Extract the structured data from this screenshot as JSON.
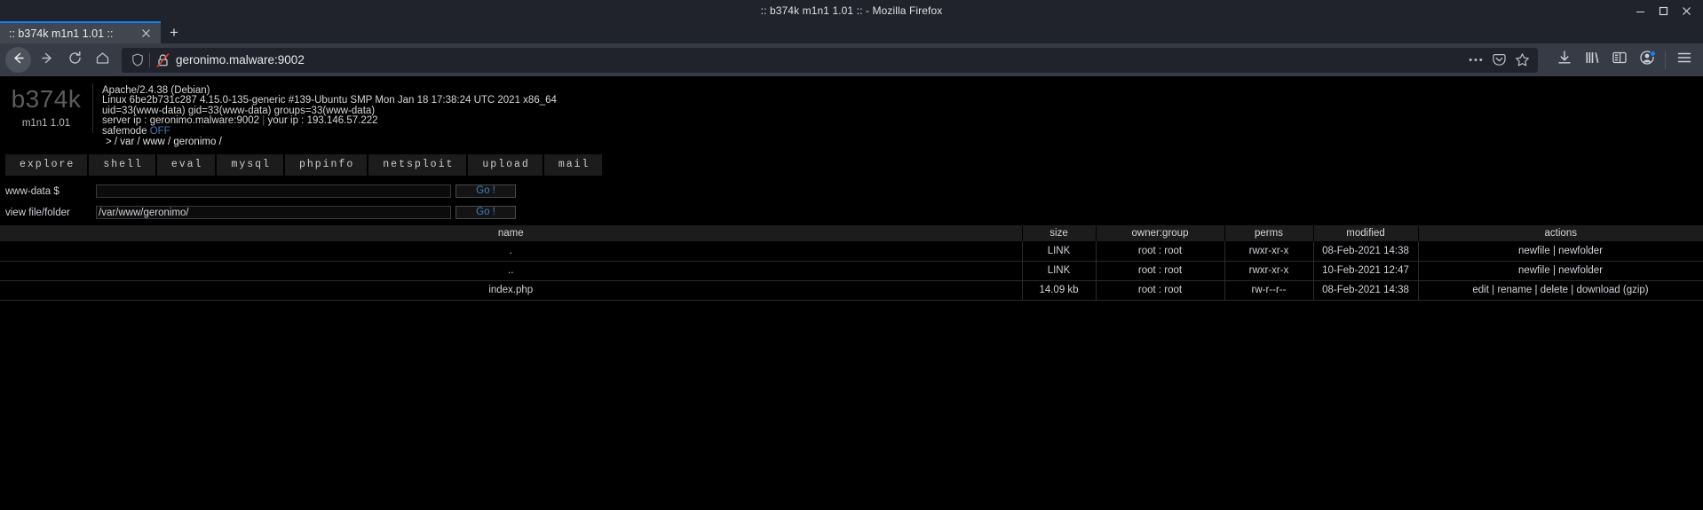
{
  "window": {
    "title": ":: b374k m1n1 1.01 :: - Mozilla Firefox",
    "minimize_label": "minimize-window",
    "maximize_label": "maximize-window",
    "close_label": "close-window"
  },
  "tabs": {
    "active_tab_title": ":: b374k m1n1 1.01 ::",
    "new_tab_label": "+"
  },
  "navigation": {
    "back_label": "back",
    "forward_label": "forward",
    "reload_label": "reload",
    "home_label": "home",
    "url": "geronimo.malware:9002",
    "page_actions_label": "page-actions",
    "pocket_label": "save-to-pocket",
    "bookmark_label": "bookmark-this-page",
    "downloads_label": "downloads",
    "library_label": "library",
    "sidebar_label": "sidebar",
    "account_label": "firefox-account",
    "menu_label": "open-application-menu"
  },
  "shell": {
    "logo": "b374k",
    "version": "m1n1 1.01",
    "sysinfo": {
      "server_software": "Apache/2.4.38 (Debian)",
      "uname": "Linux 6be2b731c287 4.15.0-135-generic #139-Ubuntu SMP Mon Jan 18 17:38:24 UTC 2021 x86_64",
      "id": "uid=33(www-data) gid=33(www-data) groups=33(www-data)",
      "server_ip_label": "server ip : ",
      "server_ip": "geronimo.malware:9002",
      "your_ip_label": " your ip : ",
      "your_ip": "193.146.57.222",
      "pipe": " | ",
      "safemode_label": "safemode ",
      "safemode_value": "OFF",
      "path_prefix": ">",
      "path_parts": [
        "/ var",
        "/ www",
        "/ geronimo",
        "/"
      ]
    },
    "nav_tabs": [
      {
        "label": "explore"
      },
      {
        "label": "shell"
      },
      {
        "label": "eval"
      },
      {
        "label": "mysql"
      },
      {
        "label": "phpinfo"
      },
      {
        "label": "netsploit"
      },
      {
        "label": "upload"
      },
      {
        "label": "mail"
      }
    ],
    "forms": [
      {
        "label": "www-data $",
        "value": "",
        "placeholder": "",
        "button": "Go !"
      },
      {
        "label": "view file/folder",
        "value": "/var/www/geronimo/",
        "placeholder": "",
        "button": "Go !"
      }
    ],
    "table": {
      "headers": [
        "name",
        "size",
        "owner:group",
        "perms",
        "modified",
        "actions"
      ],
      "rows": [
        {
          "name": ".",
          "size": "LINK",
          "owner": "root : root",
          "perms": "rwxr-xr-x",
          "modified": "08-Feb-2021 14:38",
          "actions": [
            "newfile",
            "newfolder"
          ]
        },
        {
          "name": "..",
          "size": "LINK",
          "owner": "root : root",
          "perms": "rwxr-xr-x",
          "modified": "10-Feb-2021 12:47",
          "actions": [
            "newfile",
            "newfolder"
          ]
        },
        {
          "name": "index.php",
          "size": "14.09 kb",
          "owner": "root : root",
          "perms": "rw-r--r--",
          "modified": "08-Feb-2021 14:38",
          "actions": [
            "edit",
            "rename",
            "delete",
            "download (gzip)"
          ]
        }
      ]
    }
  },
  "colors": {
    "accent_blue": "#0a84ff",
    "link_blue": "#3f7fbf",
    "page_bg": "#000000",
    "chrome_bg": "#373b45",
    "titlebar_bg": "#21232c"
  }
}
